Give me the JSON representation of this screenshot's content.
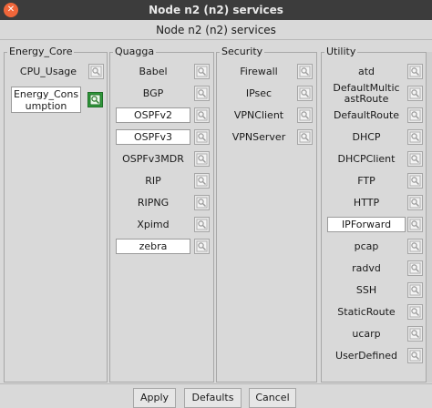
{
  "window": {
    "title": "Node n2 (n2) services",
    "subtitle": "Node n2 (n2) services"
  },
  "groups": [
    {
      "label": "Energy_Core",
      "items": [
        {
          "name": "CPU_Usage",
          "selected": false
        },
        {
          "name": "Energy_Consumption",
          "name_line1": "Energy_Cons",
          "name_line2": "umption",
          "selected": true
        }
      ]
    },
    {
      "label": "Quagga",
      "items": [
        {
          "name": "Babel",
          "selected": false
        },
        {
          "name": "BGP",
          "selected": false
        },
        {
          "name": "OSPFv2",
          "selected": true
        },
        {
          "name": "OSPFv3",
          "selected": true
        },
        {
          "name": "OSPFv3MDR",
          "selected": false
        },
        {
          "name": "RIP",
          "selected": false
        },
        {
          "name": "RIPNG",
          "selected": false
        },
        {
          "name": "Xpimd",
          "selected": false
        },
        {
          "name": "zebra",
          "selected": true
        }
      ]
    },
    {
      "label": "Security",
      "items": [
        {
          "name": "Firewall",
          "selected": false
        },
        {
          "name": "IPsec",
          "selected": false
        },
        {
          "name": "VPNClient",
          "selected": false
        },
        {
          "name": "VPNServer",
          "selected": false
        }
      ]
    },
    {
      "label": "Utility",
      "items": [
        {
          "name": "atd",
          "selected": false
        },
        {
          "name": "DefaultMulticastRoute",
          "name_line1": "DefaultMultic",
          "name_line2": "astRoute",
          "selected": false
        },
        {
          "name": "DefaultRoute",
          "selected": false
        },
        {
          "name": "DHCP",
          "selected": false
        },
        {
          "name": "DHCPClient",
          "selected": false
        },
        {
          "name": "FTP",
          "selected": false
        },
        {
          "name": "HTTP",
          "selected": false
        },
        {
          "name": "IPForward",
          "selected": true
        },
        {
          "name": "pcap",
          "selected": false
        },
        {
          "name": "radvd",
          "selected": false
        },
        {
          "name": "SSH",
          "selected": false
        },
        {
          "name": "StaticRoute",
          "selected": false
        },
        {
          "name": "ucarp",
          "selected": false
        },
        {
          "name": "UserDefined",
          "selected": false
        }
      ]
    }
  ],
  "buttons": {
    "apply": "Apply",
    "defaults": "Defaults",
    "cancel": "Cancel"
  },
  "icons": {
    "close": "close-icon",
    "configure": "configure-icon"
  },
  "colors": {
    "titlebar": "#3c3c3c",
    "close": "#f0663a",
    "active_config": "#2f9a3a",
    "selected_bg": "#ffffff"
  }
}
